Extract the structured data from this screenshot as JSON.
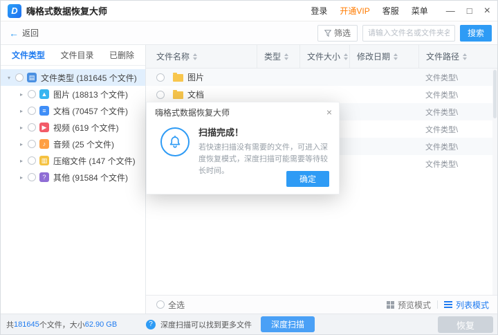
{
  "colors": {
    "accent": "#1f7bf0",
    "button_blue": "#2e9bf5",
    "vip_orange": "#ff7b00",
    "deep_scan_blue": "#4aa0f6",
    "recover_gray": "#cdd3da",
    "selected_row": "#e1effd"
  },
  "titlebar": {
    "title": "嗨格式数据恢复大师",
    "login": "登录",
    "vip": "开通VIP",
    "service": "客服",
    "menu": "菜单",
    "minimize": "—",
    "maximize": "□",
    "close": "×"
  },
  "toolbar": {
    "back": "返回",
    "filter": "筛选",
    "search_placeholder": "请输入文件名或文件夹名",
    "search_button": "搜索"
  },
  "sidebar": {
    "tabs": [
      {
        "label": "文件类型"
      },
      {
        "label": "文件目录"
      },
      {
        "label": "已删除"
      }
    ],
    "tree": [
      {
        "label": "文件类型 (181645 个文件)",
        "glyph": "▤",
        "color": "#4a90e2"
      },
      {
        "label": "图片 (18813 个文件)",
        "glyph": "▲",
        "color": "#37b5f0"
      },
      {
        "label": "文档 (70457 个文件)",
        "glyph": "≡",
        "color": "#3f8ef7"
      },
      {
        "label": "视频 (619 个文件)",
        "glyph": "▶",
        "color": "#f25b68"
      },
      {
        "label": "音频 (25 个文件)",
        "glyph": "♪",
        "color": "#ff9f43"
      },
      {
        "label": "压缩文件 (147 个文件)",
        "glyph": "▥",
        "color": "#f5c242"
      },
      {
        "label": "其他 (91584 个文件)",
        "glyph": "?",
        "color": "#8f6ed5"
      }
    ]
  },
  "table": {
    "columns": [
      "文件名称",
      "类型",
      "文件大小",
      "修改日期",
      "文件路径"
    ],
    "rows": [
      {
        "name": "图片",
        "path": "文件类型\\"
      },
      {
        "name": "文档",
        "path": "文件类型\\"
      },
      {
        "name": "",
        "path": "文件类型\\"
      },
      {
        "name": "",
        "path": "文件类型\\"
      },
      {
        "name": "",
        "path": "文件类型\\"
      },
      {
        "name": "",
        "path": "文件类型\\"
      }
    ],
    "select_all": "全选",
    "preview_mode": "预览模式",
    "list_mode": "列表模式"
  },
  "dialog": {
    "title": "嗨格式数据恢复大师",
    "close": "×",
    "heading": "扫描完成！",
    "body": "若快速扫描没有需要的文件，可进入深度恢复模式，深度扫描可能需要等待较长时间。",
    "confirm": "确定"
  },
  "statusbar": {
    "total_prefix": "共",
    "total_count": "181645",
    "total_mid": "个文件，大小",
    "total_size": "62.90 GB",
    "hint": "深度扫描可以找到更多文件",
    "deep_scan": "深度扫描",
    "recover": "恢复"
  }
}
